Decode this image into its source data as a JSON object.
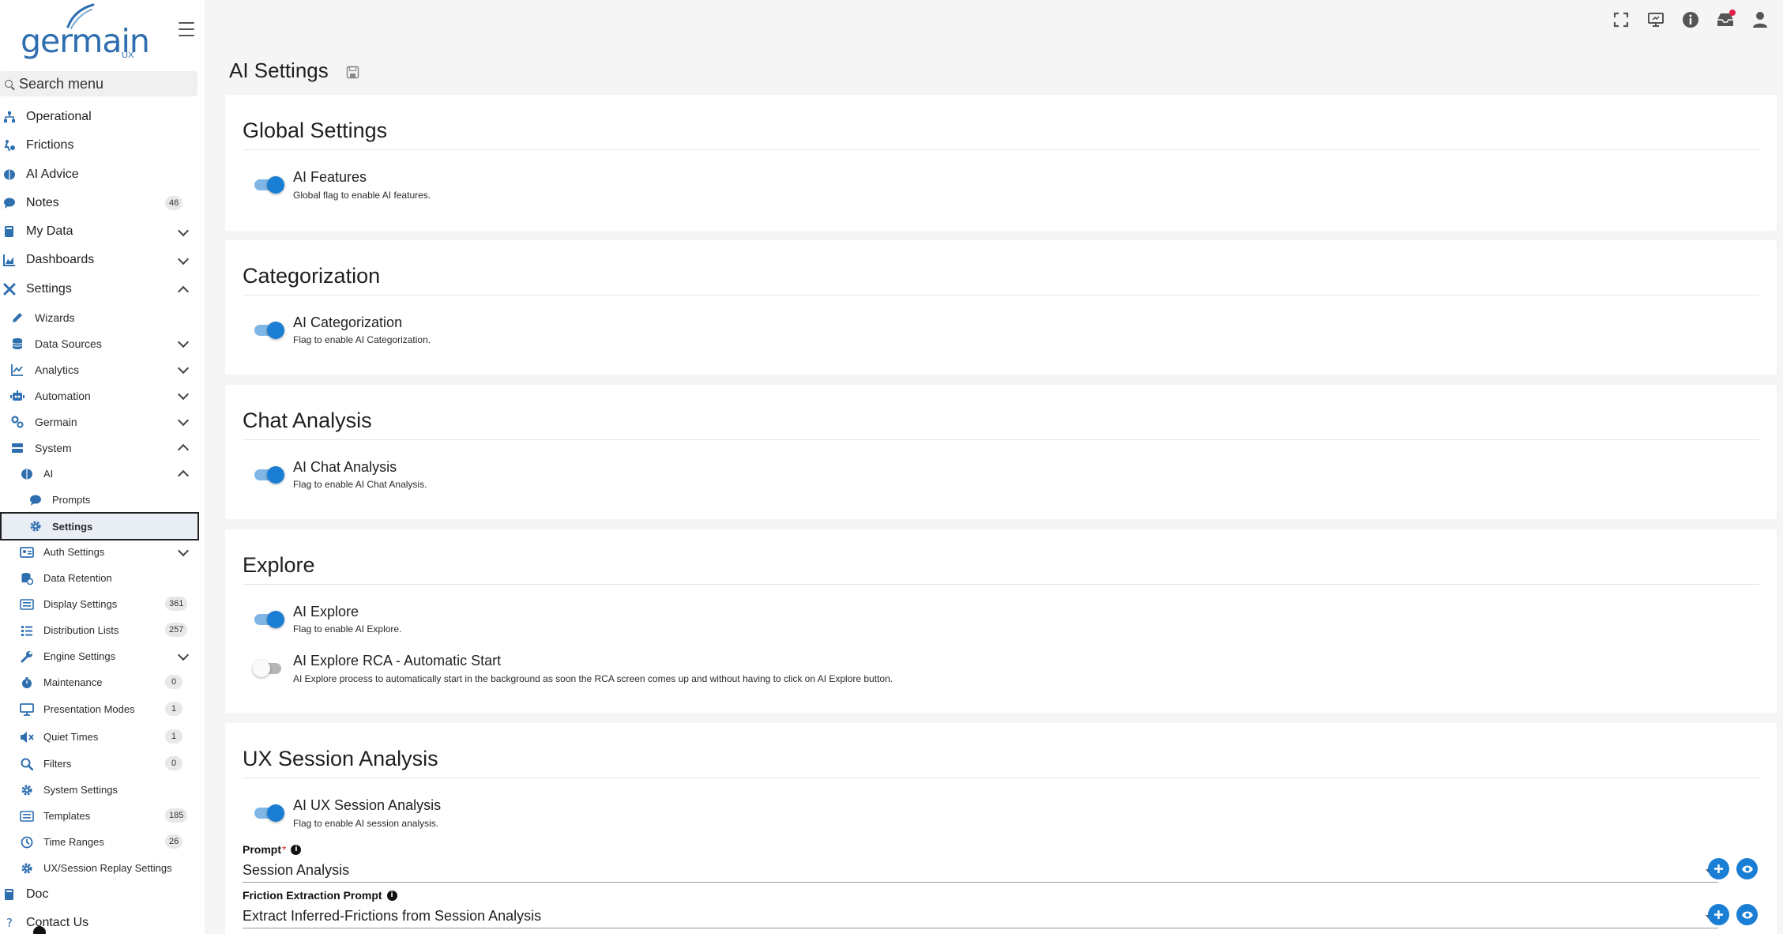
{
  "app": {
    "logo_text": "germain",
    "logo_sub": "UX"
  },
  "search": {
    "placeholder": "Search menu"
  },
  "nav": {
    "operational": "Operational",
    "frictions": "Frictions",
    "ai_advice": "AI Advice",
    "notes": "Notes",
    "notes_count": "46",
    "my_data": "My Data",
    "dashboards": "Dashboards",
    "settings": "Settings",
    "wizards": "Wizards",
    "data_sources": "Data Sources",
    "analytics": "Analytics",
    "automation": "Automation",
    "germain": "Germain",
    "system": "System",
    "ai": "AI",
    "prompts": "Prompts",
    "ai_settings": "Settings",
    "auth_settings": "Auth Settings",
    "data_retention": "Data Retention",
    "display_settings": "Display Settings",
    "display_settings_count": "361",
    "distribution_lists": "Distribution Lists",
    "distribution_lists_count": "257",
    "engine_settings": "Engine Settings",
    "maintenance": "Maintenance",
    "maintenance_count": "0",
    "presentation_modes": "Presentation Modes",
    "presentation_modes_count": "1",
    "quiet_times": "Quiet Times",
    "quiet_times_count": "1",
    "filters": "Filters",
    "filters_count": "0",
    "system_settings": "System Settings",
    "templates": "Templates",
    "templates_count": "185",
    "time_ranges": "Time Ranges",
    "time_ranges_count": "26",
    "ux_session_replay": "UX/Session Replay Settings",
    "doc": "Doc",
    "contact_us": "Contact Us"
  },
  "page": {
    "title": "AI Settings"
  },
  "sections": {
    "global": {
      "title": "Global Settings",
      "ai_features": {
        "title": "AI Features",
        "desc": "Global flag to enable AI features.",
        "enabled": true
      }
    },
    "categorization": {
      "title": "Categorization",
      "ai_categorization": {
        "title": "AI Categorization",
        "desc": "Flag to enable AI Categorization.",
        "enabled": true
      }
    },
    "chat": {
      "title": "Chat Analysis",
      "ai_chat": {
        "title": "AI Chat Analysis",
        "desc": "Flag to enable AI Chat Analysis.",
        "enabled": true
      }
    },
    "explore": {
      "title": "Explore",
      "ai_explore": {
        "title": "AI Explore",
        "desc": "Flag to enable AI Explore.",
        "enabled": true
      },
      "rca_auto": {
        "title": "AI Explore RCA - Automatic Start",
        "desc": "AI Explore process to automatically start in the background as soon the RCA screen comes up and without having to click on AI Explore button.",
        "enabled": false
      }
    },
    "ux_session": {
      "title": "UX Session Analysis",
      "ai_ux": {
        "title": "AI UX Session Analysis",
        "desc": "Flag to enable AI session analysis.",
        "enabled": true
      },
      "prompt_label": "Prompt",
      "prompt_required": "*",
      "prompt_value": "Session Analysis",
      "friction_label": "Friction Extraction Prompt",
      "friction_value": "Extract Inferred-Frictions from Session Analysis"
    }
  },
  "colors": {
    "accent": "#1a7ed4",
    "brand": "#2f6fb0",
    "notification": "#e3224e"
  }
}
